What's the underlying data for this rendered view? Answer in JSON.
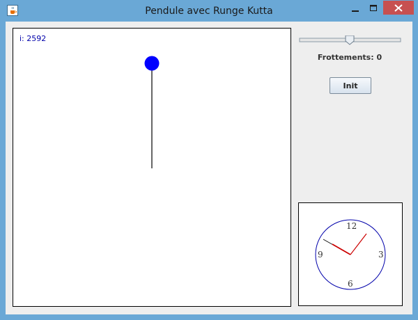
{
  "window": {
    "title": "Pendule avec Runge Kutta"
  },
  "simulation": {
    "counter_label": "i: 2592",
    "pendulum_color": "#0000ff",
    "rod_color": "#000000"
  },
  "controls": {
    "friction_slider_value": 0.5,
    "friction_label": "Frottements: 0",
    "init_label": "Init"
  },
  "clock": {
    "numerals": {
      "n12": "12",
      "n3": "3",
      "n6": "6",
      "n9": "9"
    },
    "face_color": "#0000aa",
    "hand_color": "#cc0000"
  },
  "icons": {
    "app": "java-cup-icon",
    "minimize": "minimize-icon",
    "maximize": "maximize-icon",
    "close": "close-icon"
  }
}
